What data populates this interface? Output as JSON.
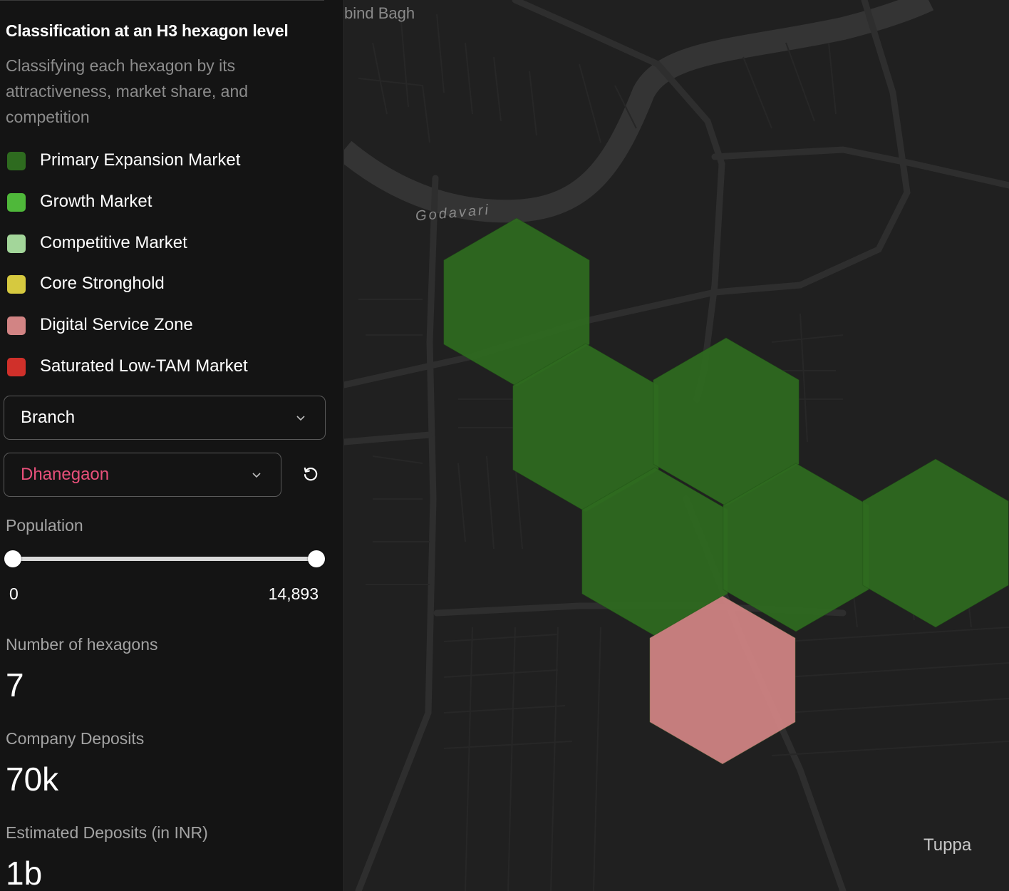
{
  "panel": {
    "title": "Classification at an H3 hexagon level",
    "subtitle": "Classifying each hexagon by its attractiveness, market share, and competition"
  },
  "legend": [
    {
      "label": "Primary Expansion Market",
      "color": "#2e6b1f"
    },
    {
      "label": "Growth Market",
      "color": "#4fb83a"
    },
    {
      "label": "Competitive Market",
      "color": "#a3d69a"
    },
    {
      "label": "Core Stronghold",
      "color": "#d6c93f"
    },
    {
      "label": "Digital Service Zone",
      "color": "#d28484"
    },
    {
      "label": "Saturated Low-TAM Market",
      "color": "#d0302a"
    }
  ],
  "filters": {
    "branch_label": "Branch",
    "location_value": "Dhanegaon",
    "location_color": "#e8507a"
  },
  "population": {
    "label": "Population",
    "min": "0",
    "max": "14,893",
    "range_fraction": [
      0,
      1
    ]
  },
  "stats": {
    "hexagons_label": "Number of hexagons",
    "hexagons_value": "7",
    "company_deposits_label": "Company Deposits",
    "company_deposits_value": "70k",
    "estimated_deposits_label": "Estimated Deposits (in INR)",
    "estimated_deposits_value": "1b"
  },
  "map": {
    "labels": {
      "top_place": "bind Bagh",
      "river": "Godavari",
      "place_bottom_right": "Tuppa"
    },
    "hexagons": [
      {
        "category": "Primary Expansion Market",
        "color": "#2e6b1f"
      },
      {
        "category": "Primary Expansion Market",
        "color": "#2e6b1f"
      },
      {
        "category": "Primary Expansion Market",
        "color": "#2e6b1f"
      },
      {
        "category": "Primary Expansion Market",
        "color": "#2e6b1f"
      },
      {
        "category": "Primary Expansion Market",
        "color": "#2e6b1f"
      },
      {
        "category": "Primary Expansion Market",
        "color": "#2e6b1f"
      },
      {
        "category": "Digital Service Zone",
        "color": "#d28484"
      }
    ]
  }
}
